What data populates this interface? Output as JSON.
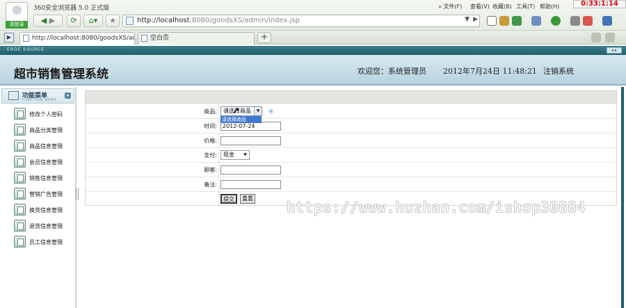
{
  "browser": {
    "title": "360安全浏览器 5.0 正式版",
    "login_label": "请登录",
    "url_host": "http://localhost",
    "url_rest": ":8080/goodsXS/admin/index.jsp",
    "menus": [
      "» 文件(F)",
      "查看(V)",
      "收藏(B)",
      "工具(T)",
      "帮助(H)"
    ],
    "clock": "0:33:1:14",
    "tabs": [
      {
        "label": "http://localhost:8080/goodsXS/ad..."
      },
      {
        "label": "空白页"
      }
    ],
    "new_tab": "+"
  },
  "app": {
    "brand": "ERDE SOURCE",
    "title": "超市销售管理系统",
    "welcome": "欢迎您：系统管理员",
    "datetime": "2012年7月24日  11:48:21",
    "logout": "注销系统"
  },
  "sidebar": {
    "title": "功能菜单",
    "subtitle": "FUNCTION MENU",
    "items": [
      {
        "label": "修改个人密码"
      },
      {
        "label": "商品分类管理"
      },
      {
        "label": "商品信息管理"
      },
      {
        "label": "会员信息管理"
      },
      {
        "label": "销售信息管理"
      },
      {
        "label": "营销广告管理"
      },
      {
        "label": "换货信息管理"
      },
      {
        "label": "退货信息管理"
      },
      {
        "label": "员工信息管理"
      }
    ]
  },
  "form": {
    "goods": {
      "label": "商品:",
      "value": "请选择商品",
      "dropdown_option": "请选择商品"
    },
    "time": {
      "label": "时间:",
      "value": "2012-07-24"
    },
    "price": {
      "label": "价格:",
      "value": ""
    },
    "payment": {
      "label": "支付:",
      "value": "现金"
    },
    "customer": {
      "label": "顾客:",
      "value": ""
    },
    "remark": {
      "label": "备注:",
      "value": ""
    },
    "submit_label": "提交",
    "reset_label": "重置"
  },
  "watermark": "https://www.huzhan.com/ishop30884",
  "colors": {
    "header_bg": "#b7d2de",
    "strip_bg": "#1f5e6b",
    "dropdown_highlight": "#3f78cf"
  }
}
